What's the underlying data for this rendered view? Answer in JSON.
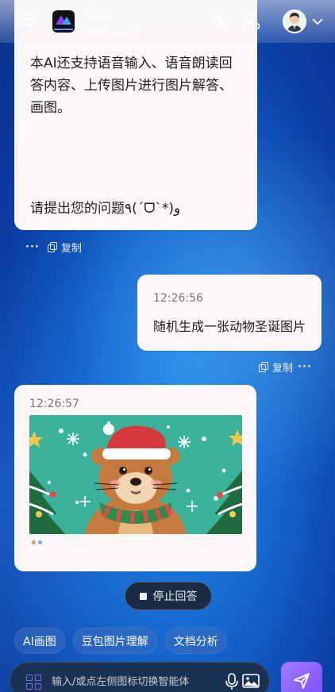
{
  "header": {
    "app_name": "AIGo",
    "subtitle": "内容由 AI 生成"
  },
  "messages": {
    "bot_intro": {
      "text": "本AI还支持语音输入、语音朗读回答内容、上传图片进行图片解答、画图。",
      "ask": "请提出您的问题٩(ˊᗜˋ*)و",
      "more_label": "···",
      "copy_label": "复制"
    },
    "user": {
      "time": "12:26:56",
      "text": "随机生成一张动物圣诞图片",
      "copy_label": "复制",
      "more_label": "···"
    },
    "bot_image": {
      "time": "12:26:57",
      "image_desc": "christmas-bear-illustration"
    }
  },
  "controls": {
    "stop_label": "停止回答"
  },
  "quick_actions": [
    "AI画图",
    "豆包图片理解",
    "文档分析"
  ],
  "composer": {
    "placeholder": "输入/或点左侧图标切换智能体"
  },
  "colors": {
    "accent": "#7a4dff",
    "bubble": "#fbf6f7",
    "background": "#1467cf"
  }
}
